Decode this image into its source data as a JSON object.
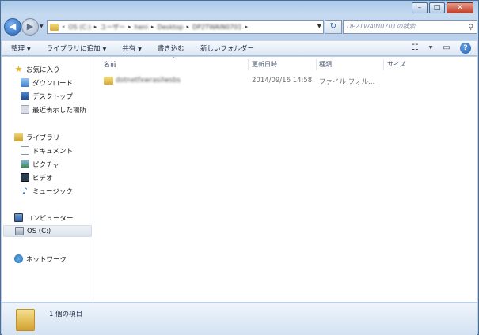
{
  "window": {
    "controls": {
      "minimize": "–",
      "maximize": "□",
      "close": "✕"
    }
  },
  "address_bar": {
    "crumbs": [
      "OS (C:)",
      "ユーザー",
      "heni",
      "Desktop",
      "DP2TWAIN0701"
    ],
    "search_placeholder": "DP2TWAIN0701の検索"
  },
  "toolbar": {
    "organize": "整理",
    "include_in_library": "ライブラリに追加",
    "share": "共有",
    "burn": "書き込む",
    "new_folder": "新しいフォルダー"
  },
  "nav_pane": {
    "favorites": {
      "label": "お気に入り",
      "items": [
        "ダウンロード",
        "デスクトップ",
        "最近表示した場所"
      ]
    },
    "libraries": {
      "label": "ライブラリ",
      "items": [
        "ドキュメント",
        "ピクチャ",
        "ビデオ",
        "ミュージック"
      ]
    },
    "computer": {
      "label": "コンピューター",
      "items": [
        "OS (C:)"
      ]
    },
    "network": {
      "label": "ネットワーク"
    }
  },
  "columns": {
    "name": "名前",
    "date_modified": "更新日時",
    "type": "種類",
    "size": "サイズ"
  },
  "files": [
    {
      "name": "dotnetfxwrasilwsbs",
      "date_modified": "2014/09/16 14:58",
      "type": "ファイル フォル..."
    }
  ],
  "status": {
    "item_count": "1 個の項目"
  },
  "icons": {
    "back": "arrow-left-icon",
    "forward": "arrow-right-icon",
    "refresh": "refresh-icon",
    "search": "search-icon",
    "view": "view-options-icon",
    "preview": "preview-pane-icon",
    "help": "help-icon"
  }
}
